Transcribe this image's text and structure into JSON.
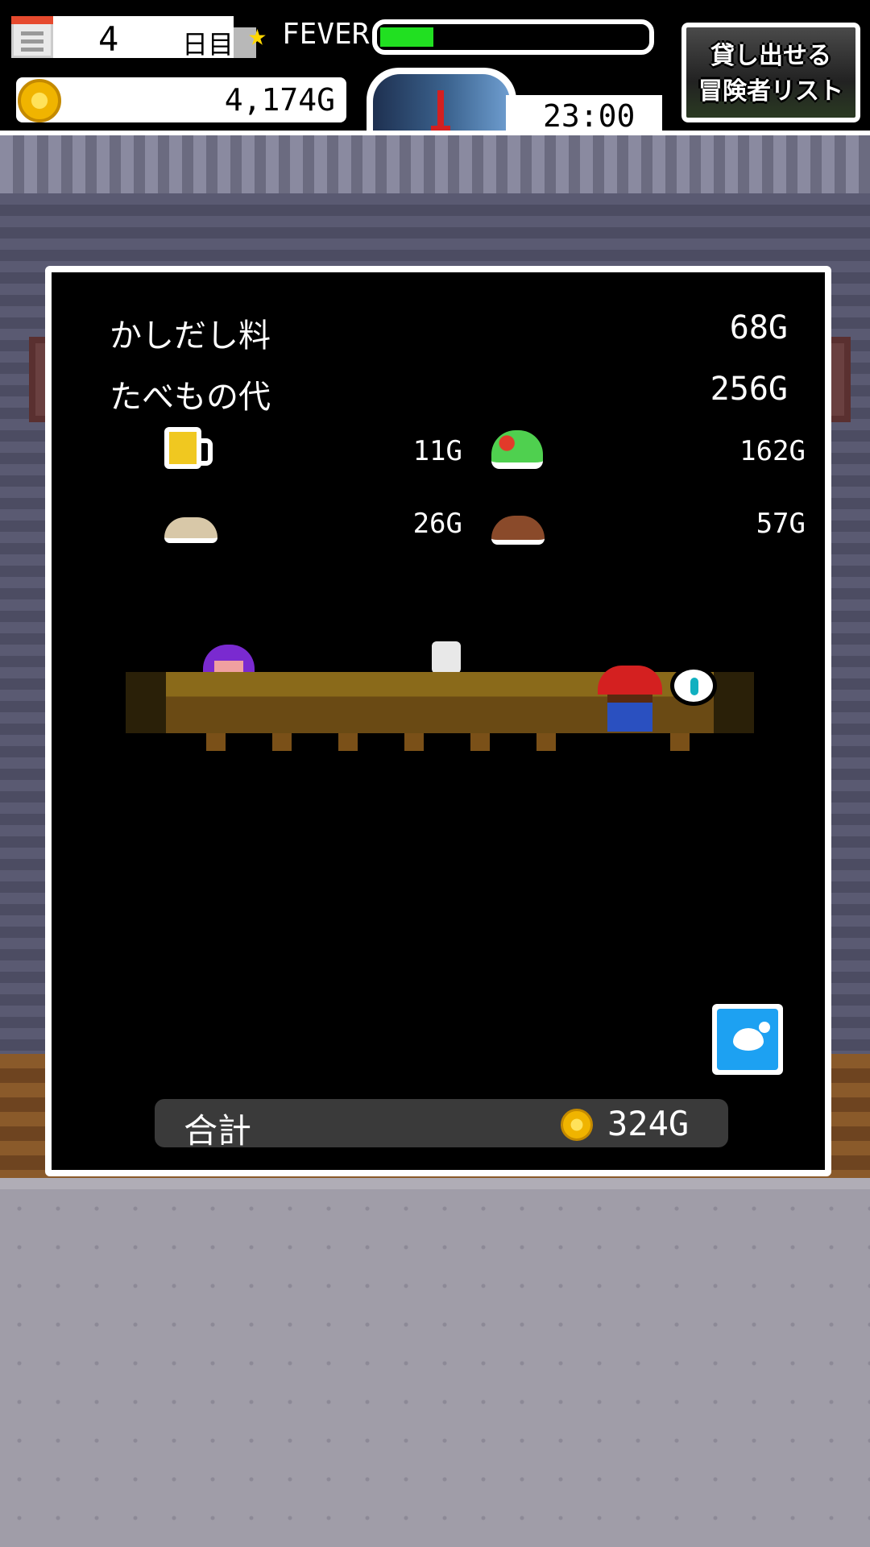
{
  "hud": {
    "day_number": "4",
    "day_unit": "日目",
    "fever_label": "FEVER",
    "fever_level": 0.2,
    "gold": "4,174G",
    "time": "23:00",
    "rent_list_button": {
      "line1": "貸し出せる",
      "line2": "冒険者リスト"
    }
  },
  "receipt": {
    "rental_fee_label": "かしだし料",
    "rental_fee": "68G",
    "food_cost_label": "たべもの代",
    "food_cost": "256G",
    "food_items": [
      {
        "icon": "beer-icon",
        "price": "11G"
      },
      {
        "icon": "salad-icon",
        "price": "162G"
      },
      {
        "icon": "rice-plate-icon",
        "price": "26G"
      },
      {
        "icon": "meat-plate-icon",
        "price": "57G"
      }
    ],
    "total_label": "合計",
    "total_value": "324G"
  },
  "colors": {
    "fever_fill": "#21e021",
    "gold_coin": "#f0b400",
    "share_button": "#1da1f2"
  }
}
